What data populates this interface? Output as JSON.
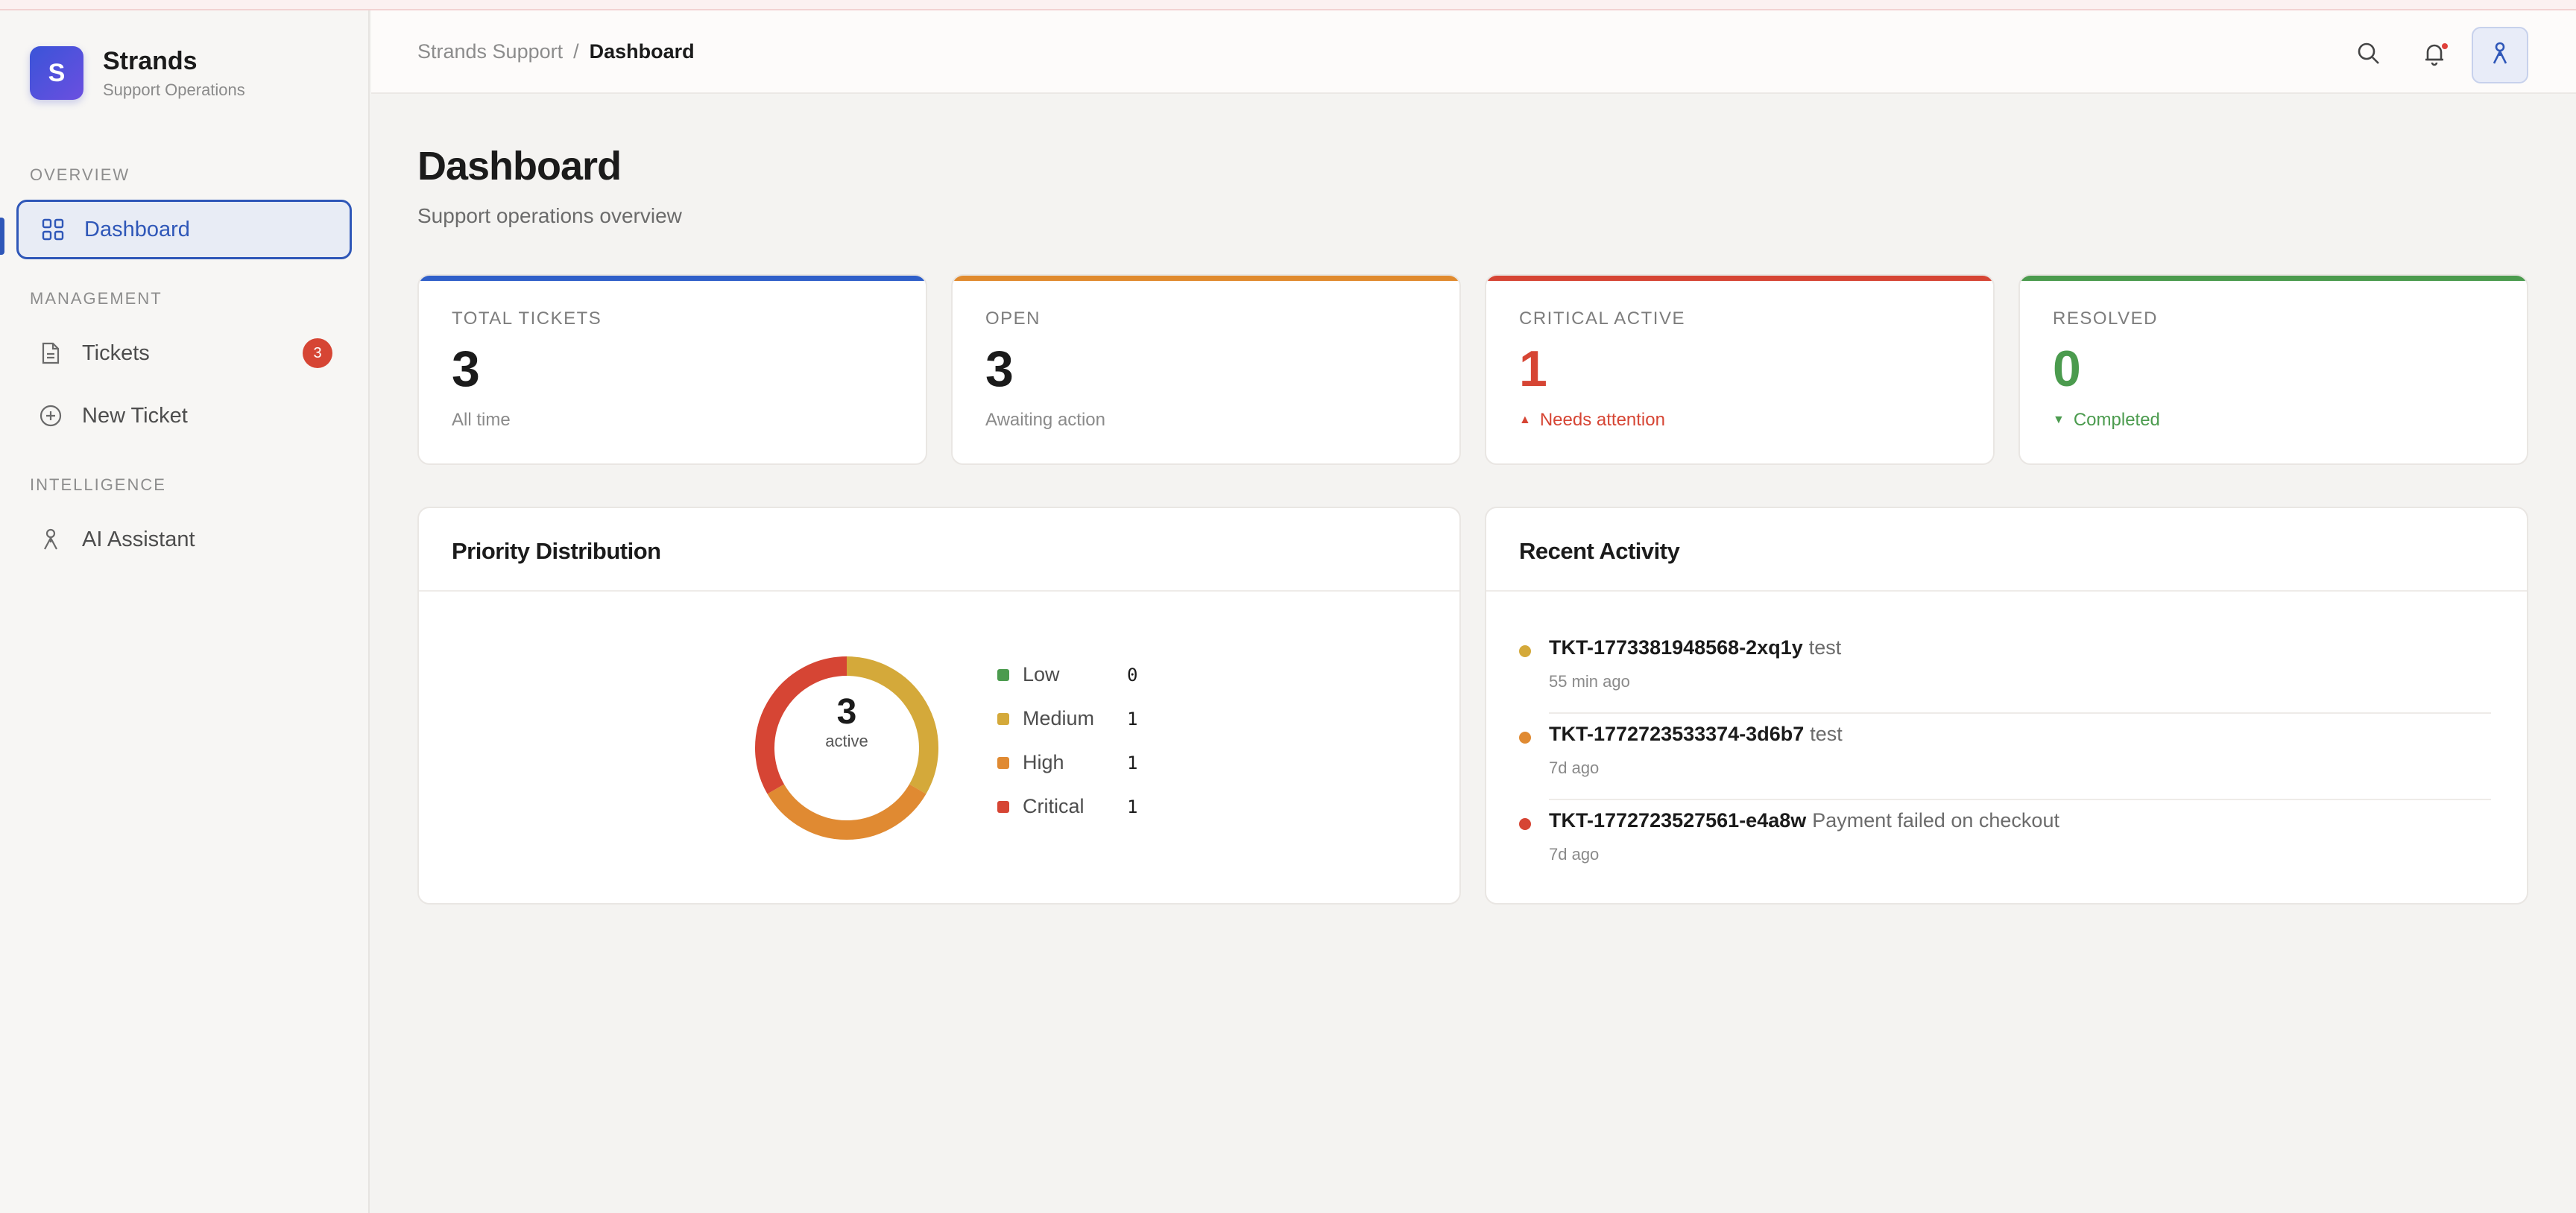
{
  "brand": {
    "logo_letter": "S",
    "name": "Strands",
    "subtitle": "Support Operations"
  },
  "sidebar": {
    "sections": [
      {
        "label": "OVERVIEW"
      },
      {
        "label": "MANAGEMENT"
      },
      {
        "label": "INTELLIGENCE"
      }
    ],
    "items": [
      {
        "label": "Dashboard",
        "icon": "grid-icon",
        "active": true
      },
      {
        "label": "Tickets",
        "icon": "document-icon",
        "badge": "3"
      },
      {
        "label": "New Ticket",
        "icon": "plus-circle-icon"
      },
      {
        "label": "AI Assistant",
        "icon": "person-icon"
      }
    ]
  },
  "header": {
    "breadcrumb_root": "Strands Support",
    "breadcrumb_sep": "/",
    "breadcrumb_current": "Dashboard",
    "icons": [
      "search-icon",
      "bell-icon",
      "person-icon"
    ]
  },
  "page": {
    "title": "Dashboard",
    "subtitle": "Support operations overview"
  },
  "stats": [
    {
      "label": "TOTAL TICKETS",
      "value": "3",
      "note": "All time",
      "accent": "#2f5fc9",
      "value_color": "#1b1b1b",
      "note_color": "#8a8a8a"
    },
    {
      "label": "OPEN",
      "value": "3",
      "note": "Awaiting action",
      "accent": "#e08a2e",
      "value_color": "#1b1b1b",
      "note_color": "#8a8a8a"
    },
    {
      "label": "CRITICAL ACTIVE",
      "value": "1",
      "note": "Needs attention",
      "trend": "up",
      "accent": "#d64534",
      "value_color": "#d64534",
      "note_color": "#d64534"
    },
    {
      "label": "RESOLVED",
      "value": "0",
      "note": "Completed",
      "trend": "down",
      "accent": "#4b9b4e",
      "value_color": "#4b9b4e",
      "note_color": "#4b9b4e"
    }
  ],
  "priority": {
    "title": "Priority Distribution",
    "center_value": "3",
    "center_label": "active",
    "legend": [
      {
        "label": "Low",
        "count": "0",
        "color": "#4b9b4e"
      },
      {
        "label": "Medium",
        "count": "1",
        "color": "#d4a93a"
      },
      {
        "label": "High",
        "count": "1",
        "color": "#e08a32"
      },
      {
        "label": "Critical",
        "count": "1",
        "color": "#d64534"
      }
    ]
  },
  "chart_data": {
    "type": "pie",
    "categories": [
      "Low",
      "Medium",
      "High",
      "Critical"
    ],
    "values": [
      0,
      1,
      1,
      1
    ],
    "title": "Priority Distribution"
  },
  "activity": {
    "title": "Recent Activity",
    "items": [
      {
        "id": "TKT-1773381948568-2xq1y",
        "desc": "test",
        "time": "55 min ago",
        "color": "#d4a93a"
      },
      {
        "id": "TKT-1772723533374-3d6b7",
        "desc": "test",
        "time": "7d ago",
        "color": "#e08a32"
      },
      {
        "id": "TKT-1772723527561-e4a8w",
        "desc": "Payment failed on checkout",
        "time": "7d ago",
        "color": "#d64534"
      }
    ]
  }
}
